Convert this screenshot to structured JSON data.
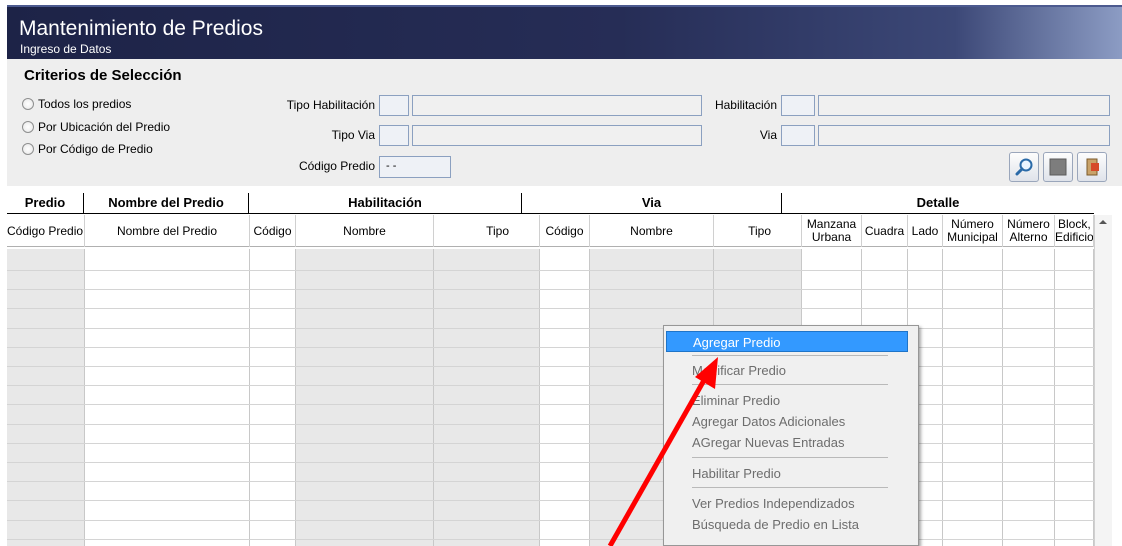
{
  "window": {
    "title": "Mantenimiento de Predios",
    "subtitle": "Ingreso de Datos"
  },
  "criteria": {
    "title": "Criterios de Selección",
    "options": [
      "Todos los predios",
      "Por Ubicación del Predio",
      "Por Código de Predio"
    ],
    "tipo_habilitacion_label": "Tipo Habilitación",
    "habilitacion_label": "Habilitación",
    "tipo_via_label": "Tipo Via",
    "via_label": "Via",
    "codigo_predio_label": "Código Predio",
    "codigo_predio_value": " - -"
  },
  "toolbar": {
    "icons": [
      "search-icon",
      "blank-icon",
      "exit-door-icon"
    ]
  },
  "grid": {
    "groups": [
      "Predio",
      "Nombre del Predio",
      "Habilitación",
      "Via",
      "Detalle"
    ],
    "columns": [
      "Código Predio",
      "Nombre del Predio",
      "Código",
      "Nombre",
      "Tipo",
      "Código",
      "Nombre",
      "Tipo",
      "Manzana Urbana",
      "Cuadra",
      "Lado",
      "Número Municipal",
      "Número Alterno",
      "Block, Edificio"
    ]
  },
  "context_menu": {
    "items": [
      "Agregar Predio",
      "Modificar Predio",
      "Eliminar Predio",
      "Agregar Datos Adicionales",
      "AGregar Nuevas Entradas",
      "Habilitar Predio",
      "Ver Predios Independizados",
      "Búsqueda de Predio en Lista"
    ]
  },
  "colors": {
    "title_bar": "#1d2347",
    "menu_highlight": "#3399ff",
    "annotation_arrow": "#ff0000"
  }
}
